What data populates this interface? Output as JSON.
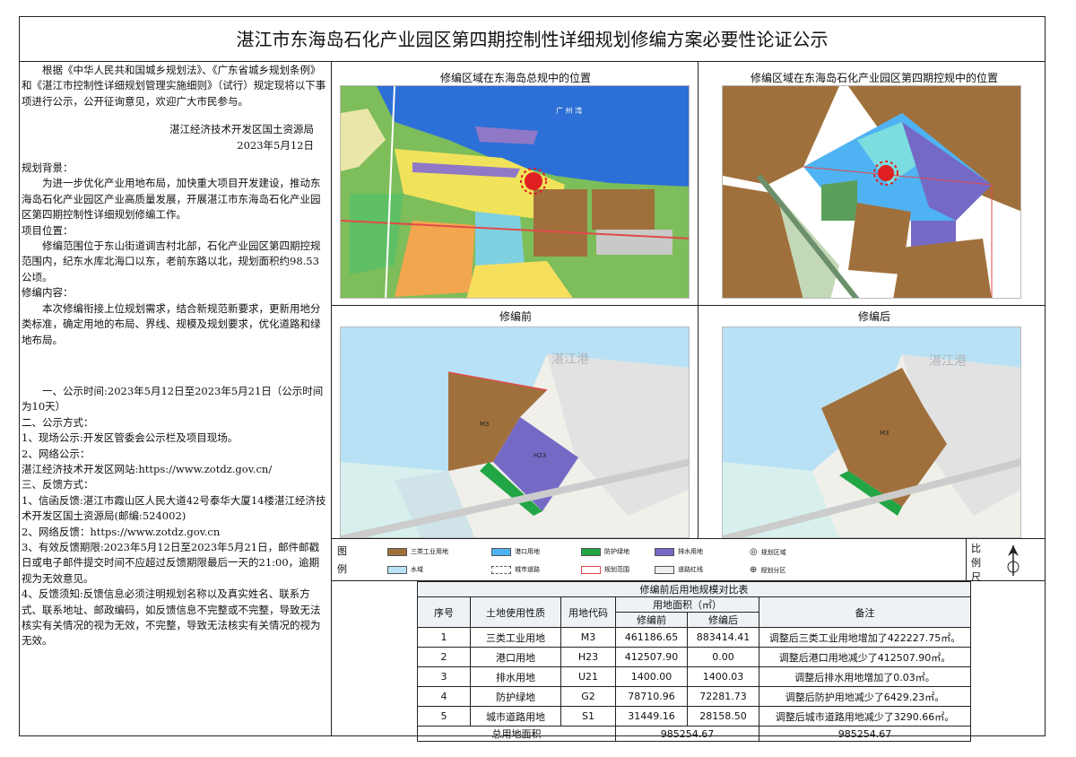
{
  "title": "湛江市东海岛石化产业园区第四期控制性详细规划修编方案必要性论证公示",
  "left": {
    "intro": "根据《中华人民共和国城乡规划法》、《广东省城乡规划条例》和《湛江市控制性详细规划管理实施细则》（试行）规定现将以下事项进行公示，公开征询意见，欢迎广大市民参与。",
    "org": "湛江经济技术开发区国土资源局",
    "date": "2023年5月12日",
    "bg_head": "规划背景：",
    "bg_text": "为进一步优化产业用地布局，加快重大项目开发建设，推动东海岛石化产业园区产业高质量发展，开展湛江市东海岛石化产业园区第四期控制性详细规划修编工作。",
    "loc_head": "项目位置：",
    "loc_text": "修编范围位于东山街道调吉村北部，石化产业园区第四期控规范围内，纪东水库北海口以东，老前东路以北，规划面积约98.53公顷。",
    "content_head": "修编内容：",
    "content_text": "本次修编衔接上位规划需求，结合新规范新要求，更新用地分类标准，确定用地的布局、界线、规模及规划要求，优化道路和绿地布局。",
    "p1": "一、公示时间:2023年5月12日至2023年5月21日（公示时间为10天）",
    "p2": "二、公示方式：",
    "p3": "1、现场公示:开发区管委会公示栏及项目现场。",
    "p4": "2、网络公示：",
    "p5": "湛江经济技术开发区网站:https://www.zotdz.gov.cn/",
    "p6": "三、反馈方式：",
    "p7": "1、信函反馈:湛江市霞山区人民大道42号泰华大厦14楼湛江经济技术开发区国土资源局(邮编:524002)",
    "p8": "2、网络反馈：https://www.zotdz.gov.cn",
    "p9": "3、有效反馈期限:2023年5月12日至2023年5月21日，邮件邮戳日或电子邮件提交时间不应超过反馈期限最后一天的21:00，逾期视为无效意见。",
    "p10": "4、反馈须知:反馈信息必须注明规划名称以及真实姓名、联系方式、联系地址、邮政编码，如反馈信息不完整或不完整，导致无法核实有关情况的视为无效，不完整，导致无法核实有关情况的视为无效。"
  },
  "panels": {
    "tl": "修编区域在东海岛总规中的位置",
    "tr": "修编区域在东海岛石化产业园区第四期控规中的位置",
    "bl": "修编前",
    "br": "修编后",
    "harbor": "湛江港",
    "sea_label": "广 州 湾"
  },
  "legend": {
    "label": "图例",
    "items": [
      "三类工业用地",
      "港口用地",
      "防护绿地",
      "排水用地",
      "水域",
      "城市道路",
      "规划范围",
      "道路红线",
      "规划区域",
      "规划分区"
    ],
    "scale_label": "比例尺"
  },
  "table": {
    "caption": "修编前后用地规模对比表",
    "h_no": "序号",
    "h_type": "土地使用性质",
    "h_code": "用地代码",
    "h_area": "用地面积（㎡）",
    "h_before": "修编前",
    "h_after": "修编后",
    "h_note": "备注",
    "rows": [
      {
        "no": "1",
        "type": "三类工业用地",
        "code": "M3",
        "before": "461186.65",
        "after": "883414.41",
        "note": "调整后三类工业用地增加了422227.75㎡。"
      },
      {
        "no": "2",
        "type": "港口用地",
        "code": "H23",
        "before": "412507.90",
        "after": "0.00",
        "note": "调整后港口用地减少了412507.90㎡。"
      },
      {
        "no": "3",
        "type": "排水用地",
        "code": "U21",
        "before": "1400.00",
        "after": "1400.03",
        "note": "调整后排水用地增加了0.03㎡。"
      },
      {
        "no": "4",
        "type": "防护绿地",
        "code": "G2",
        "before": "78710.96",
        "after": "72281.73",
        "note": "调整后防护用地减少了6429.23㎡。"
      },
      {
        "no": "5",
        "type": "城市道路用地",
        "code": "S1",
        "before": "31449.16",
        "after": "28158.50",
        "note": "调整后城市道路用地减少了3290.66㎡。"
      }
    ],
    "total_label": "总用地面积",
    "total_before": "985254.67",
    "total_after": "985254.67"
  },
  "map_labels": {
    "m3": "M3",
    "h23": "H23",
    "g2": "G2",
    "u21": "U21"
  }
}
